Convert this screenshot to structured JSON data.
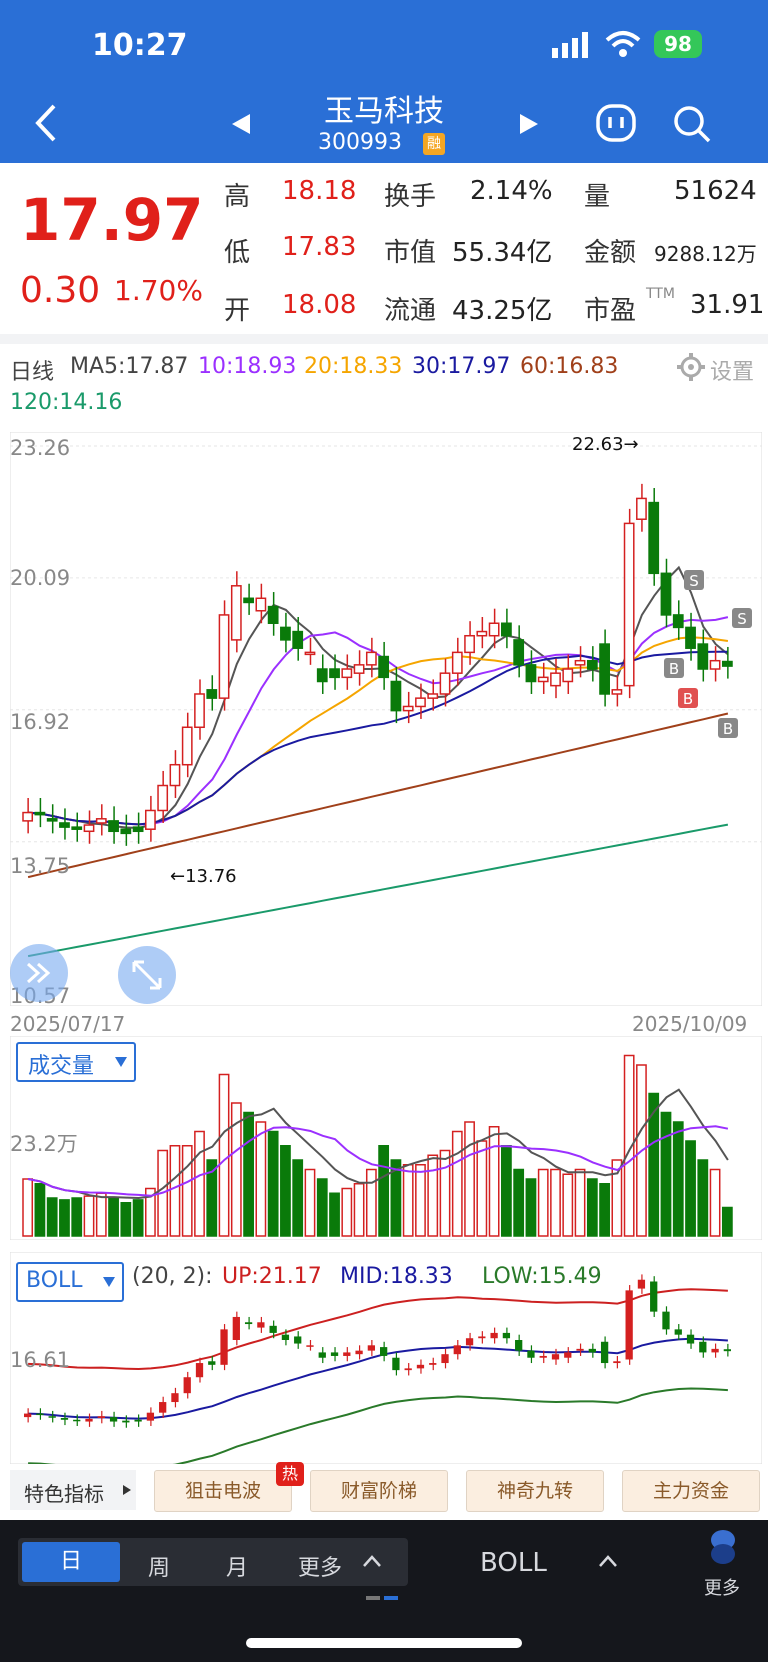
{
  "status": {
    "time": "10:27",
    "battery": "98"
  },
  "header": {
    "title": "玉马科技",
    "code": "300993",
    "badge": "融"
  },
  "quote": {
    "price": "17.97",
    "change": "0.30",
    "change_pct": "1.70%",
    "rows": [
      [
        {
          "l": "高",
          "v": "18.18"
        },
        {
          "l": "换手",
          "v": "2.14%"
        },
        {
          "l": "量",
          "v": "51624"
        }
      ],
      [
        {
          "l": "低",
          "v": "17.83"
        },
        {
          "l": "市值",
          "v": "55.34亿"
        },
        {
          "l": "金额",
          "v": "9288.12万"
        }
      ],
      [
        {
          "l": "开",
          "v": "18.08"
        },
        {
          "l": "流通",
          "v": "43.25亿"
        },
        {
          "l": "市盈",
          "v": "31.91",
          "sup": "TTM"
        }
      ]
    ]
  },
  "ma_bar": {
    "period": "日线",
    "ma5": "MA5:17.87",
    "ma10": "10:18.93",
    "ma20": "20:18.33",
    "ma30": "30:17.97",
    "ma60": "60:16.83",
    "ma120": "120:14.16",
    "settings": "设置",
    "colors": {
      "ma5": "#555555",
      "ma10": "#9b30ff",
      "ma20": "#f5a500",
      "ma30": "#1a1aa0",
      "ma60": "#a0401a",
      "ma120": "#1a9a6a"
    }
  },
  "kline": {
    "y_labels": [
      "23.26",
      "20.09",
      "16.92",
      "13.75",
      "10.57"
    ],
    "max_label": "22.63→",
    "min_label": "←13.76",
    "date_start": "2025/07/17",
    "date_end": "2025/10/09",
    "markers": [
      "S",
      "S",
      "B",
      "B",
      "B",
      "B"
    ]
  },
  "volume": {
    "selector": "成交量",
    "y_label": "23.2万"
  },
  "boll": {
    "selector": "BOLL",
    "params": "(20, 2):",
    "up": "UP:21.17",
    "mid": "MID:18.33",
    "low": "LOW:15.49",
    "y_label": "16.61"
  },
  "indicators": {
    "label": "特色指标",
    "tabs": [
      "狙击电波",
      "财富阶梯",
      "神奇九转",
      "主力资金"
    ],
    "hot": "热"
  },
  "footer": {
    "periods": [
      "日",
      "周",
      "月",
      "更多"
    ],
    "indicator": "BOLL",
    "more": "更多"
  },
  "chart_data": {
    "type": "candlestick",
    "date_range": [
      "2025/07/17",
      "2025/10/09"
    ],
    "ylim": [
      10.57,
      23.26
    ],
    "high": 22.63,
    "low": 13.76,
    "close": 17.97
  }
}
